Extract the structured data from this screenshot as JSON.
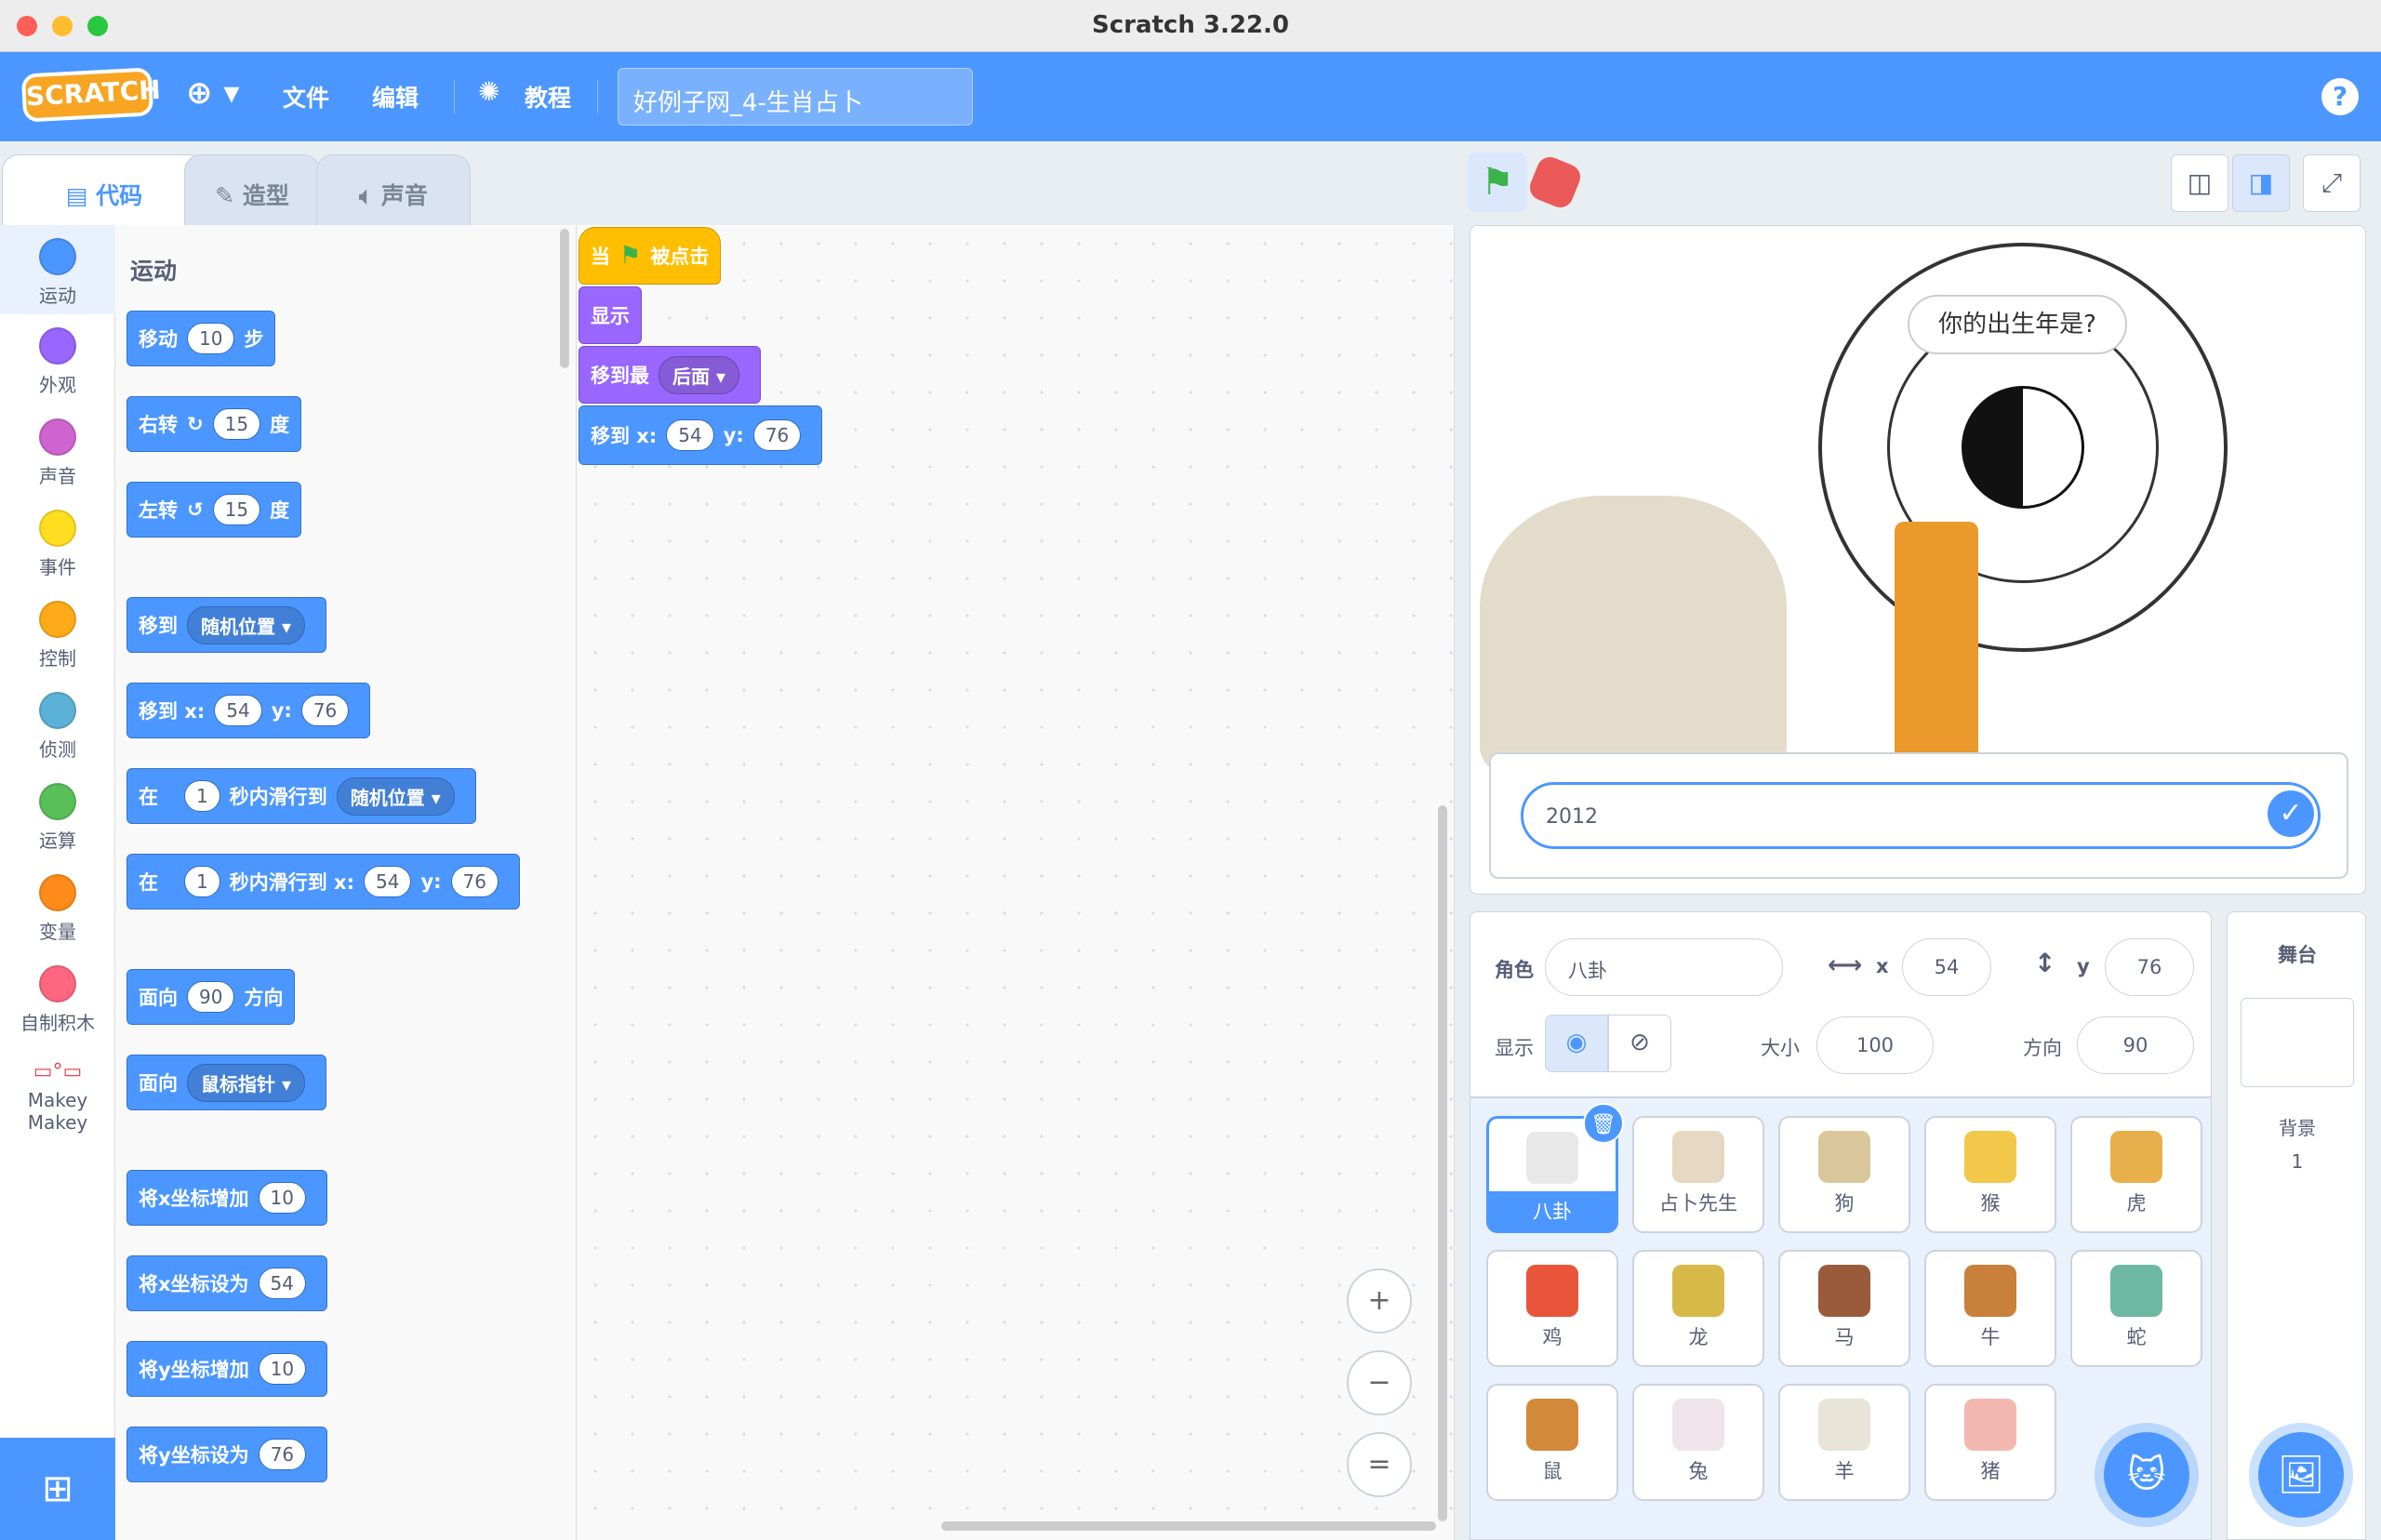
{
  "window": {
    "title": "Scratch 3.22.0"
  },
  "menu": {
    "logo": "SCRATCH",
    "file": "文件",
    "edit": "编辑",
    "tutorials": "教程",
    "project_title": "好例子网_4-生肖占卜",
    "help": "?"
  },
  "tabs": {
    "code": "代码",
    "costumes": "造型",
    "sounds": "声音"
  },
  "categories": [
    {
      "label": "运动",
      "color": "#4c97ff"
    },
    {
      "label": "外观",
      "color": "#9966ff"
    },
    {
      "label": "声音",
      "color": "#cf63cf"
    },
    {
      "label": "事件",
      "color": "#ffde20"
    },
    {
      "label": "控制",
      "color": "#ffab19"
    },
    {
      "label": "侦测",
      "color": "#5cb1d6"
    },
    {
      "label": "运算",
      "color": "#59c059"
    },
    {
      "label": "变量",
      "color": "#ff8c1a"
    },
    {
      "label": "自制积木",
      "color": "#ff6680"
    },
    {
      "label": "Makey Makey",
      "color": "#ff6680"
    }
  ],
  "palette": {
    "header": "运动",
    "move": {
      "w1": "移动",
      "v": "10",
      "w2": "步"
    },
    "turn_right": {
      "w1": "右转",
      "v": "15",
      "w2": "度"
    },
    "turn_left": {
      "w1": "左转",
      "v": "15",
      "w2": "度"
    },
    "goto_random": {
      "w1": "移到",
      "dd": "随机位置"
    },
    "goto_xy": {
      "w1": "移到 x:",
      "x": "54",
      "w2": "y:",
      "y": "76"
    },
    "glide_random": {
      "w1": "在",
      "v": "1",
      "w2": "秒内滑行到",
      "dd": "随机位置"
    },
    "glide_xy": {
      "w1": "在",
      "v": "1",
      "w2": "秒内滑行到 x:",
      "x": "54",
      "w3": "y:",
      "y": "76"
    },
    "point_dir": {
      "w1": "面向",
      "v": "90",
      "w2": "方向"
    },
    "point_towards": {
      "w1": "面向",
      "dd": "鼠标指针"
    },
    "change_x": {
      "w1": "将x坐标增加",
      "v": "10"
    },
    "set_x": {
      "w1": "将x坐标设为",
      "v": "54"
    },
    "change_y": {
      "w1": "将y坐标增加",
      "v": "10"
    },
    "set_y": {
      "w1": "将y坐标设为",
      "v": "76"
    }
  },
  "script": {
    "hat": {
      "w1": "当",
      "w2": "被点击"
    },
    "show": "显示",
    "layer": {
      "w1": "移到最",
      "dd": "后面"
    },
    "goto": {
      "w1": "移到 x:",
      "x": "54",
      "w2": "y:",
      "y": "76"
    }
  },
  "stage": {
    "bubble": "你的出生年是?",
    "answer": "2012",
    "ok_icon": "✓"
  },
  "sprite_info": {
    "sprite_label": "角色",
    "sprite_name": "八卦",
    "x_label": "x",
    "x": "54",
    "y_label": "y",
    "y": "76",
    "show_label": "显示",
    "size_label": "大小",
    "size": "100",
    "direction_label": "方向",
    "direction": "90"
  },
  "sprites": [
    {
      "name": "八卦",
      "color": "#e8e8e8",
      "selected": true
    },
    {
      "name": "占卜先生",
      "color": "#e6d8c2"
    },
    {
      "name": "狗",
      "color": "#d9c79b"
    },
    {
      "name": "猴",
      "color": "#f1c84a"
    },
    {
      "name": "虎",
      "color": "#e7b04a"
    },
    {
      "name": "鸡",
      "color": "#e9553a"
    },
    {
      "name": "龙",
      "color": "#d7b94a"
    },
    {
      "name": "马",
      "color": "#9a5b3b"
    },
    {
      "name": "牛",
      "color": "#c9803a"
    },
    {
      "name": "蛇",
      "color": "#6cb8a0"
    },
    {
      "name": "鼠",
      "color": "#d28a3a"
    },
    {
      "name": "兔",
      "color": "#eee4ea"
    },
    {
      "name": "羊",
      "color": "#e8e4d8"
    },
    {
      "name": "猪",
      "color": "#f2b8b0"
    }
  ],
  "stage_pane": {
    "title": "舞台",
    "backdrop_label": "背景",
    "backdrop_count": "1"
  },
  "icons": {
    "globe": "🌐",
    "bulb": "💡",
    "flag": "⚑",
    "stop": "⬣",
    "zoom_in": "+",
    "zoom_out": "−",
    "zoom_reset": "=",
    "delete": "🗑",
    "add_sprite": "🐱",
    "add_backdrop": "🖼",
    "extension": "⊞"
  }
}
